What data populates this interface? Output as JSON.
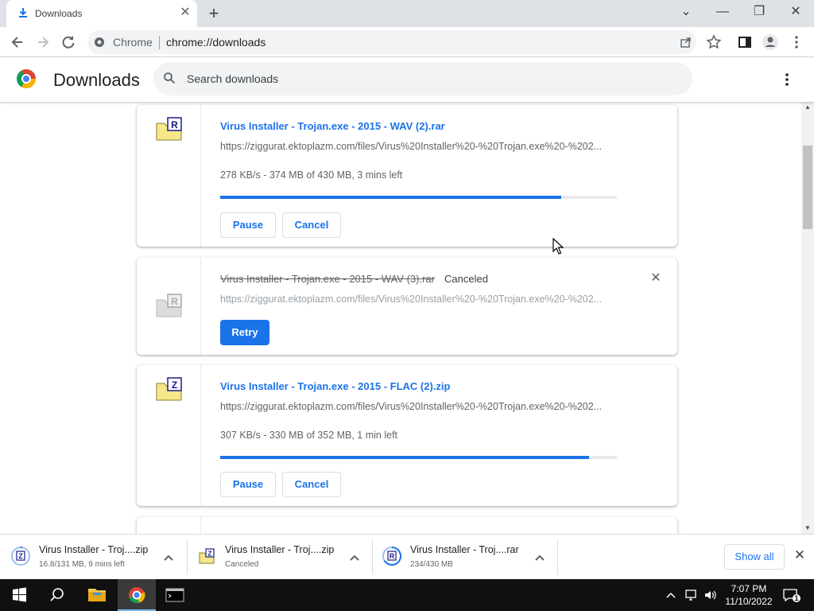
{
  "tab": {
    "title": "Downloads",
    "close": "✕",
    "new_tab": "+"
  },
  "window": {
    "minimize": "—",
    "maximize": "❐",
    "close": "✕",
    "tab_search": "⌄"
  },
  "toolbar": {
    "omnibox_label": "Chrome",
    "url": "chrome://downloads"
  },
  "page": {
    "title": "Downloads",
    "search_placeholder": "Search downloads"
  },
  "downloads": [
    {
      "name": "Virus Installer - Trojan.exe - 2015 - WAV (2).rar",
      "url": "https://ziggurat.ektoplazm.com/files/Virus%20Installer%20-%20Trojan.exe%20-%202...",
      "status": "278 KB/s - 374 MB of 430 MB, 3 mins left",
      "progress": 0.86,
      "buttons": {
        "pause": "Pause",
        "cancel": "Cancel"
      },
      "icon_letter": "R"
    },
    {
      "name": "Virus Installer - Trojan.exe - 2015 - WAV (3).rar",
      "tag": "Canceled",
      "url": "https://ziggurat.ektoplazm.com/files/Virus%20Installer%20-%20Trojan.exe%20-%202...",
      "buttons": {
        "retry": "Retry"
      },
      "icon_letter": "R"
    },
    {
      "name": "Virus Installer - Trojan.exe - 2015 - FLAC (2).zip",
      "url": "https://ziggurat.ektoplazm.com/files/Virus%20Installer%20-%20Trojan.exe%20-%202...",
      "status": "307 KB/s - 330 MB of 352 MB, 1 min left",
      "progress": 0.93,
      "buttons": {
        "pause": "Pause",
        "cancel": "Cancel"
      },
      "icon_letter": "Z"
    }
  ],
  "shelf": {
    "items": [
      {
        "name": "Virus Installer - Troj....zip",
        "sub": "16.8/131 MB, 9 mins left",
        "icon_letter": "Z"
      },
      {
        "name": "Virus Installer - Troj....zip",
        "sub": "Canceled",
        "icon_letter": "Z"
      },
      {
        "name": "Virus Installer - Troj....rar",
        "sub": "234/430 MB",
        "icon_letter": "R"
      }
    ],
    "show_all": "Show all"
  },
  "taskbar": {
    "time": "7:07 PM",
    "date": "11/10/2022",
    "notifications": "1"
  },
  "colors": {
    "accent": "#1a73e8",
    "tab_strip": "#dee1e6",
    "taskbar": "#101010"
  }
}
